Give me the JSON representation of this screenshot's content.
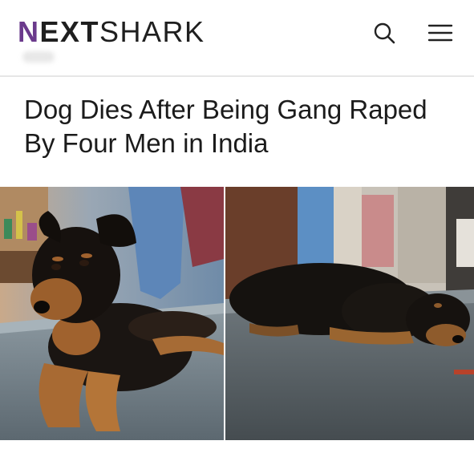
{
  "header": {
    "logo": {
      "first": "N",
      "mid": "EXT",
      "last": "SHARK"
    },
    "search_icon": "search-icon",
    "menu_icon": "hamburger-menu-icon"
  },
  "article": {
    "headline": "Dog Dies After Being Gang Raped By Four Men in India"
  },
  "colors": {
    "brand_accent": "#6b3a8c",
    "text": "#1b1b1b",
    "divider": "#e6e6e6"
  }
}
